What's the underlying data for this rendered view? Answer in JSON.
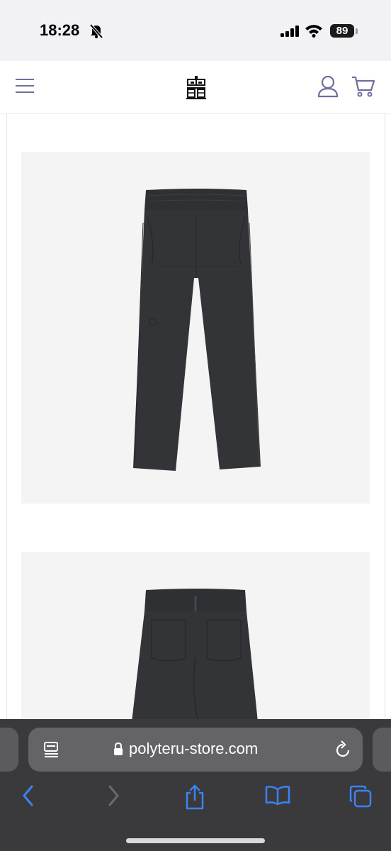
{
  "status_bar": {
    "time": "18:28",
    "battery": "89"
  },
  "site": {
    "logo_name": "polyteru-logo",
    "accent_color": "#6e6e9e"
  },
  "products": {
    "images": [
      {
        "alt": "charcoal sweatpants front view"
      },
      {
        "alt": "charcoal sweatpants back view"
      }
    ]
  },
  "browser": {
    "url": "polyteru-store.com",
    "tint_color": "#3b82f6"
  }
}
